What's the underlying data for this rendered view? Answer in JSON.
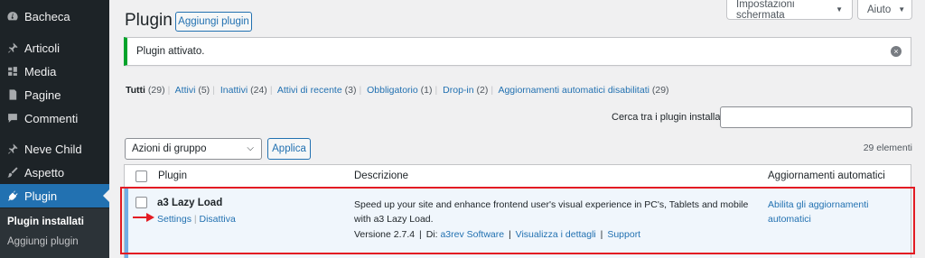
{
  "sidebar": {
    "items": [
      {
        "label": "Bacheca",
        "icon": "dashboard-icon"
      },
      {
        "label": "Articoli",
        "icon": "pin-icon"
      },
      {
        "label": "Media",
        "icon": "media-icon"
      },
      {
        "label": "Pagine",
        "icon": "page-icon"
      },
      {
        "label": "Commenti",
        "icon": "comment-icon"
      },
      {
        "label": "Neve Child",
        "icon": "pin-icon"
      },
      {
        "label": "Aspetto",
        "icon": "brush-icon"
      },
      {
        "label": "Plugin",
        "icon": "plugin-icon"
      }
    ],
    "submenu": [
      "Plugin installati",
      "Aggiungi plugin"
    ]
  },
  "header": {
    "title": "Plugin",
    "add_button": "Aggiungi plugin",
    "screen_options": "Impostazioni schermata",
    "help": "Aiuto"
  },
  "notice": {
    "text": "Plugin attivato.",
    "dismiss_symbol": "×"
  },
  "filters": [
    {
      "label": "Tutti",
      "count": "(29)"
    },
    {
      "label": "Attivi",
      "count": "(5)"
    },
    {
      "label": "Inattivi",
      "count": "(24)"
    },
    {
      "label": "Attivi di recente",
      "count": "(3)"
    },
    {
      "label": "Obbligatorio",
      "count": "(1)"
    },
    {
      "label": "Drop-in",
      "count": "(2)"
    },
    {
      "label": "Aggiornamenti automatici disabilitati",
      "count": "(29)"
    }
  ],
  "search": {
    "label": "Cerca tra i plugin installati",
    "value": ""
  },
  "bulk": {
    "selected": "Azioni di gruppo",
    "apply": "Applica"
  },
  "item_count": "29 elementi",
  "table": {
    "columns": [
      "Plugin",
      "Descrizione",
      "Aggiornamenti automatici"
    ],
    "rows": [
      {
        "name": "a3 Lazy Load",
        "actions": [
          "Settings",
          "Disattiva"
        ],
        "description": "Speed up your site and enhance frontend user's visual experience in PC's, Tablets and mobile with a3 Lazy Load.",
        "version_text": "Versione 2.7.4",
        "by_text": "Di:",
        "author": "a3rev Software",
        "details_link": "Visualizza i dettagli",
        "support_link": "Support",
        "auto_update_link": "Abilita gli aggiornamenti automatici"
      }
    ]
  },
  "colors": {
    "sidebar_bg": "#1d2327",
    "accent": "#2271b1",
    "notice_success": "#00a32a",
    "annotation_red": "#e31b23"
  }
}
